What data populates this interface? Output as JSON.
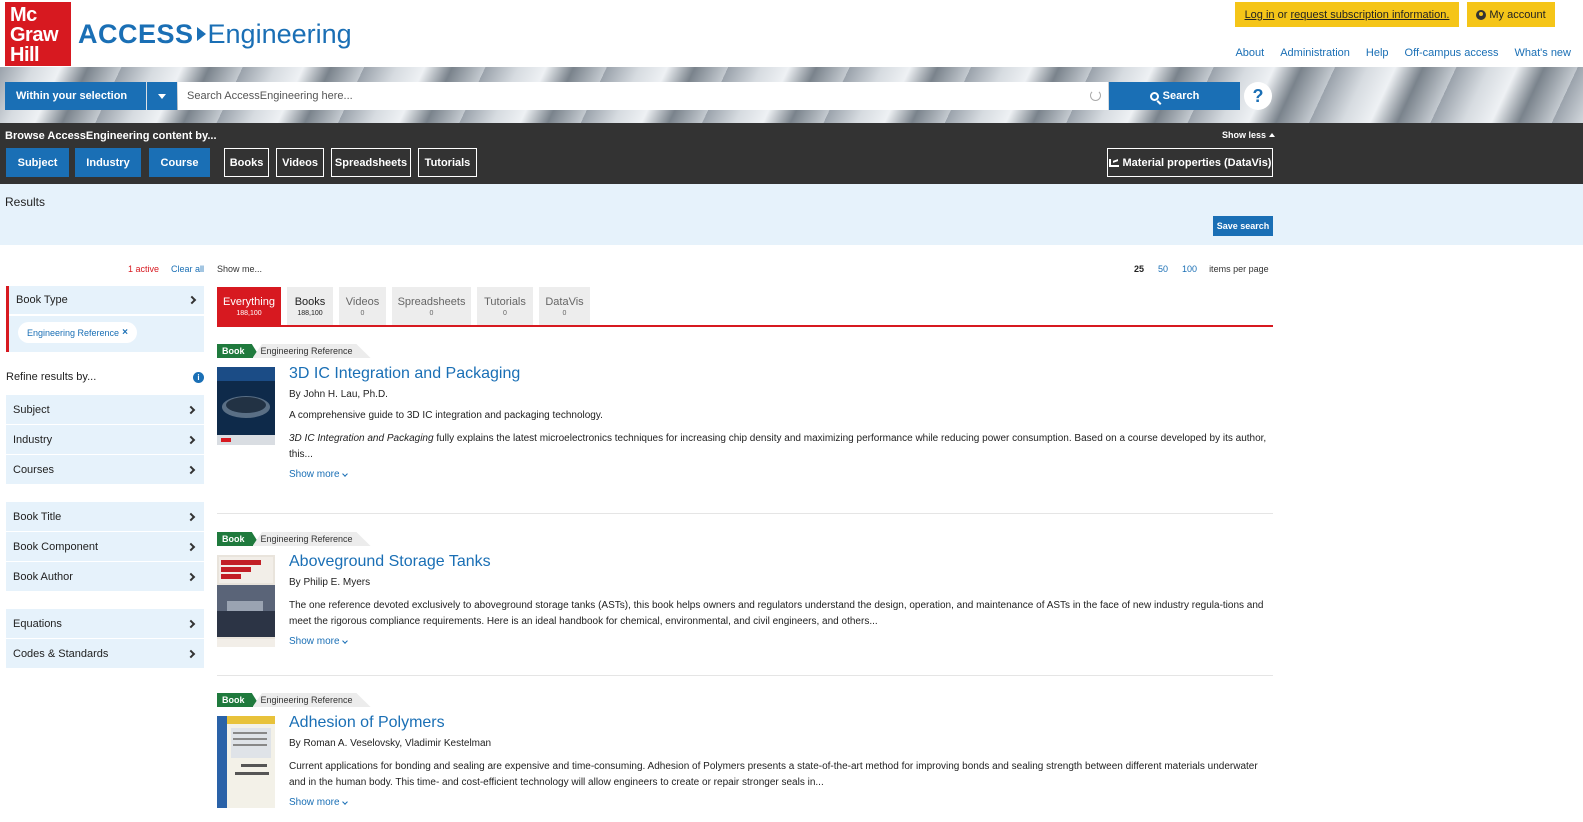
{
  "header": {
    "logo_lines": [
      "Mc",
      "Graw",
      "Hill"
    ],
    "brand_access": "ACCESS",
    "brand_engineering": "Engineering",
    "login": {
      "login_text": "Log in",
      "or_text": " or ",
      "request_text": "request subscription information."
    },
    "my_account": "My account",
    "toplinks": [
      "About",
      "Administration",
      "Help",
      "Off-campus access",
      "What's new"
    ]
  },
  "search": {
    "scope_label": "Within your selection",
    "placeholder": "Search AccessEngineering here...",
    "button_label": "Search",
    "help_label": "?"
  },
  "browse": {
    "label": "Browse AccessEngineering content by...",
    "show_less": "Show less",
    "primary_buttons": [
      "Subject",
      "Industry",
      "Course"
    ],
    "outline_buttons": [
      "Books",
      "Videos",
      "Spreadsheets",
      "Tutorials"
    ],
    "datavis_button": "Material properties (DataVis)"
  },
  "results_strip": {
    "title": "Results",
    "save_search": "Save search"
  },
  "sidebar": {
    "active_count": "1 active",
    "clear_all": "Clear all",
    "book_type": "Book Type",
    "active_tag": "Engineering Reference",
    "refine_label": "Refine results by...",
    "group1": [
      "Subject",
      "Industry",
      "Courses"
    ],
    "group2": [
      "Book Title",
      "Book Component",
      "Book Author"
    ],
    "group3": [
      "Equations",
      "Codes & Standards"
    ]
  },
  "main": {
    "show_me": "Show me...",
    "per_page": {
      "current": "25",
      "options": [
        "50",
        "100"
      ],
      "label": "items per page"
    },
    "tabs": [
      {
        "label": "Everything",
        "count": "188,100"
      },
      {
        "label": "Books",
        "count": "188,100"
      },
      {
        "label": "Videos",
        "count": "0"
      },
      {
        "label": "Spreadsheets",
        "count": "0"
      },
      {
        "label": "Tutorials",
        "count": "0"
      },
      {
        "label": "DataVis",
        "count": "0"
      }
    ],
    "results": [
      {
        "badge": "Book",
        "type": "Engineering Reference",
        "title": "3D IC Integration and Packaging",
        "author": "By John H. Lau, Ph.D.",
        "summary": "A comprehensive guide to 3D IC integration and packaging technology.",
        "desc_italic": "3D IC Integration and Packaging",
        "desc_rest": " fully explains the latest microelectronics techniques for increasing chip density and maximizing performance while reducing power consumption. Based on a course developed by its author, this...",
        "more": "Show more"
      },
      {
        "badge": "Book",
        "type": "Engineering Reference",
        "title": "Aboveground Storage Tanks",
        "author": "By Philip E. Myers",
        "desc": "The one reference devoted exclusively to aboveground storage tanks (ASTs), this book helps owners and regulators understand the design, operation, and maintenance of ASTs in the face of new industry regula-tions and meet the rigorous compliance requirements. Here is an ideal handbook for chemical, environmental, and civil engineers, and others...",
        "more": "Show more"
      },
      {
        "badge": "Book",
        "type": "Engineering Reference",
        "title": "Adhesion of Polymers",
        "author": "By Roman A. Veselovsky, Vladimir Kestelman",
        "desc": "Current applications for bonding and sealing are expensive and time-consuming. Adhesion of Polymers presents a state-of-the-art method for improving bonds and sealing strength between different materials underwater and in the human body. This time- and cost-efficient technology will allow engineers to create or repair stronger seals in...",
        "more": "Show more"
      }
    ]
  },
  "colors": {
    "brand_blue": "#1a6fb5",
    "brand_red": "#d71920",
    "yellow": "#f5c518",
    "badge_green": "#1f7a3d"
  }
}
